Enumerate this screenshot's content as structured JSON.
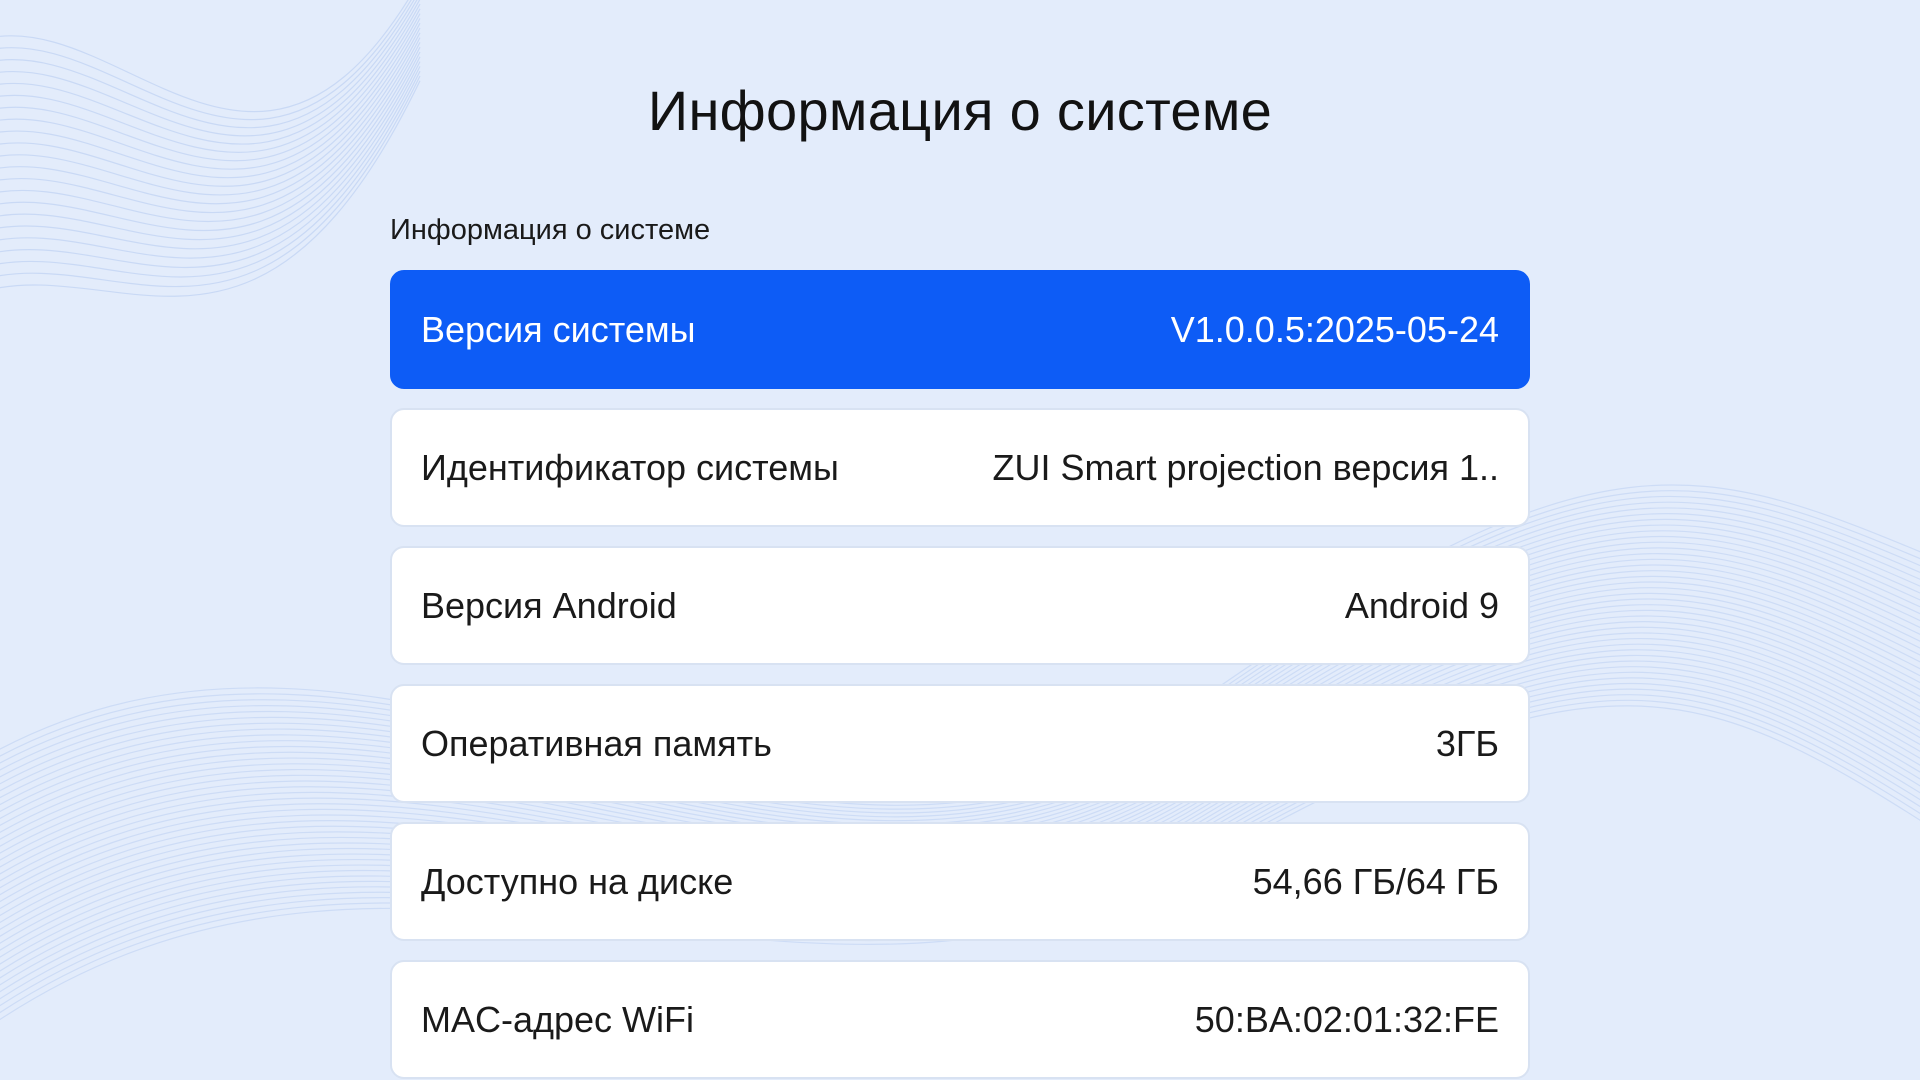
{
  "page": {
    "title": "Информация о системе",
    "section_label": "Информация о системе"
  },
  "rows": [
    {
      "label": "Версия системы",
      "value": "V1.0.0.5:2025-05-24",
      "focused": true
    },
    {
      "label": "Идентификатор системы",
      "value": "ZUI Smart projection версия 1.."
    },
    {
      "label": "Версия Android",
      "value": "Android 9"
    },
    {
      "label": "Оперативная память",
      "value": "3ГБ"
    },
    {
      "label": "Доступно на диске",
      "value": "54,66 ГБ/64 ГБ"
    },
    {
      "label": "MAC-адрес WiFi",
      "value": "50:BA:02:01:32:FE"
    }
  ],
  "colors": {
    "background": "#e3ecfb",
    "focus_accent": "#0d5cf6",
    "card": "#ffffff"
  }
}
